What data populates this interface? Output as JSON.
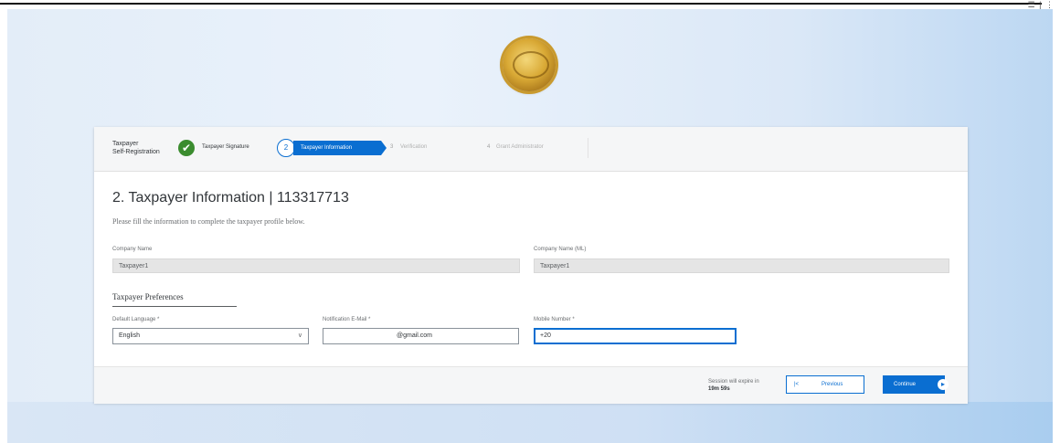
{
  "window": {
    "corner_mark": "☰ | ⋮"
  },
  "stepper": {
    "app_title_line1": "Taxpayer",
    "app_title_line2": "Self-Registration",
    "steps": [
      {
        "num": "✔",
        "label": "Taxpayer Signature",
        "state": "done"
      },
      {
        "num": "2",
        "label": "Taxpayer Information",
        "state": "active"
      },
      {
        "num": "3",
        "label": "Verification",
        "state": "pending"
      },
      {
        "num": "4",
        "label": "Grant Administrator",
        "state": "pending"
      }
    ]
  },
  "main": {
    "title": "2. Taxpayer Information | 113317713",
    "subtitle": "Please fill the information to complete the taxpayer profile below.",
    "company_name_label": "Company Name",
    "company_name_value": "Taxpayer1",
    "company_name_ml_label": "Company Name (ML)",
    "company_name_ml_value": "Taxpayer1",
    "section_heading": "Taxpayer Preferences",
    "default_language_label": "Default Language *",
    "default_language_value": "English",
    "email_label": "Notification E-Mail *",
    "email_value": "@gmail.com",
    "mobile_label": "Mobile Number *",
    "mobile_value": "+20"
  },
  "footer": {
    "session_text": "Session will expire in",
    "session_time": "19m 59s",
    "previous_label": "Previous",
    "previous_icon": "|<",
    "continue_label": "Continue",
    "continue_icon": "▸"
  },
  "colors": {
    "accent": "#0a6ed1",
    "success": "#3b8c2f",
    "logo_gold": "#d9a935"
  }
}
